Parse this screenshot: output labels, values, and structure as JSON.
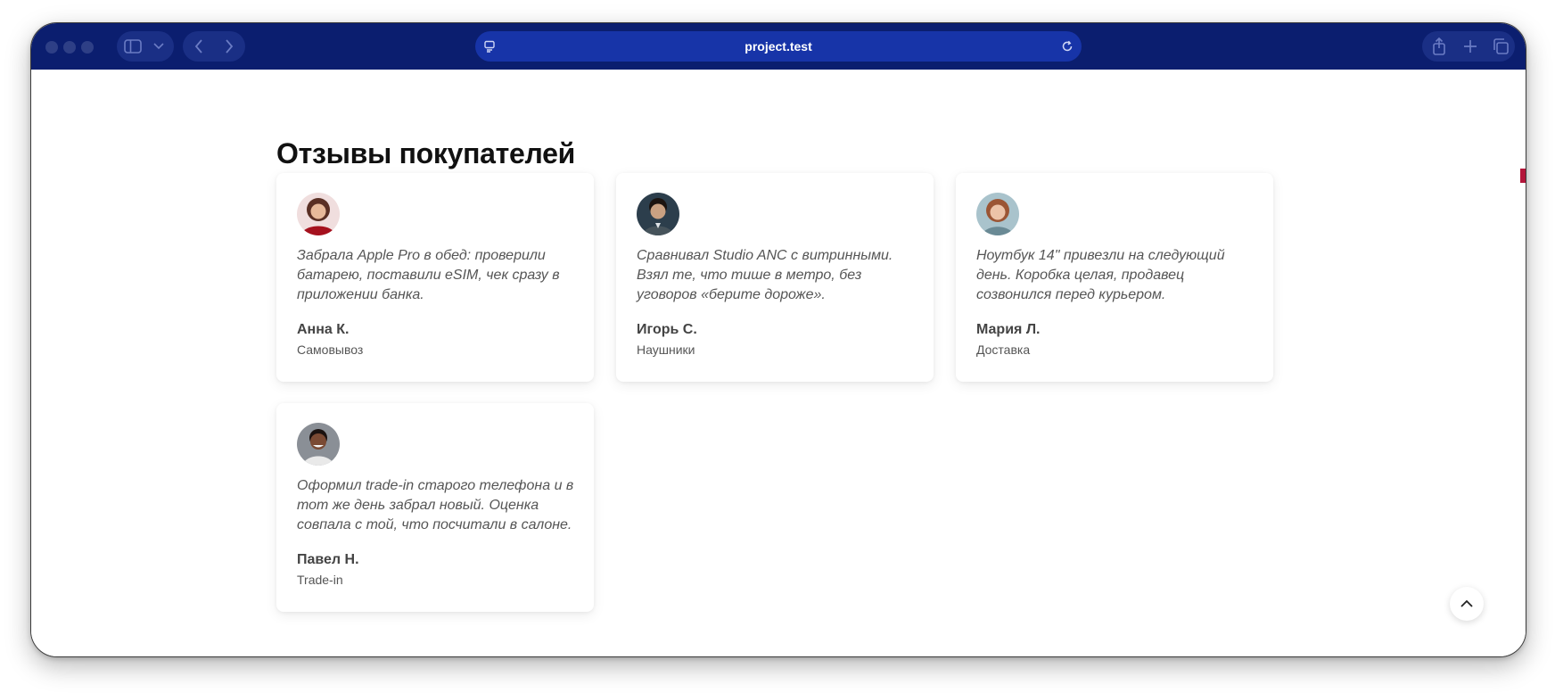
{
  "browser": {
    "url": "project.test",
    "icons": [
      "sidebar-icon",
      "chevron-down-icon",
      "back-icon",
      "forward-icon",
      "page-icon",
      "reload-icon",
      "share-icon",
      "plus-icon",
      "tabs-icon"
    ],
    "toolbar_color": "#0b1e6f"
  },
  "page": {
    "heading": "Отзывы покупателей",
    "reviews": [
      {
        "text": "Забрала Apple Pro в обед: проверили батарею, поставили eSIM, чек сразу в приложении банка.",
        "author": "Анна К.",
        "meta": "Самовывоз"
      },
      {
        "text": "Сравнивал Studio ANC с витринными. Взял те, что тише в метро, без уговоров «берите дороже».",
        "author": "Игорь С.",
        "meta": "Наушники"
      },
      {
        "text": "Ноутбук 14\" привезли на следующий день. Коробка целая, продавец созвонился перед курьером.",
        "author": "Мария Л.",
        "meta": "Доставка"
      },
      {
        "text": "Оформил trade-in старого телефона и в тот же день забрал новый. Оценка совпала с той, что посчитали в салоне.",
        "author": "Павел Н.",
        "meta": "Trade-in"
      }
    ],
    "scroll_top_icon": "chevron-up-icon",
    "accent_color": "#b3163a"
  }
}
